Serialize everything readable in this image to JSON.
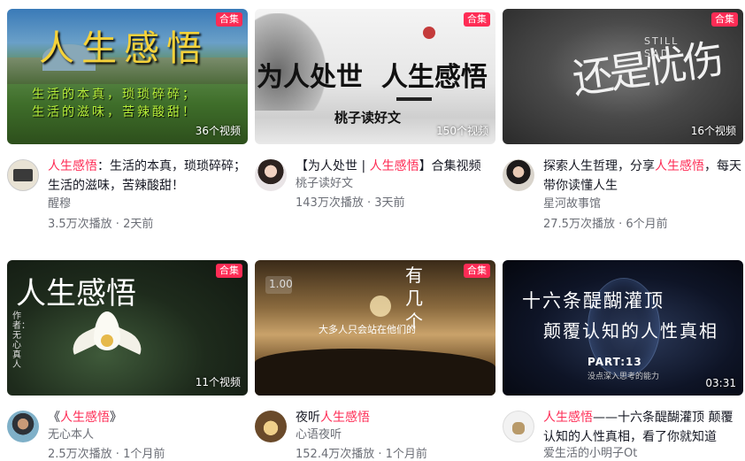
{
  "cards": [
    {
      "thumb_title": "人生感悟",
      "thumb_lines": [
        "生活的本真，琐琐碎碎；",
        "生活的滋味，苦辣酸甜！"
      ],
      "badge": "合集",
      "count": "36个视频",
      "title_pre": "",
      "title_hl": "人生感悟",
      "title_post": "：生活的本真，琐琐碎碎；生活的滋味，苦辣酸甜！",
      "author": "醒穆",
      "meta": "3.5万次播放 · 2天前"
    },
    {
      "thumb_title": "为人处世  人生感悟",
      "thumb_sub": "桃子读好文",
      "badge": "合集",
      "count": "150个视频",
      "title_pre": "【为人处世 | ",
      "title_hl": "人生感悟",
      "title_post": "】合集视频",
      "author": "桃子读好文",
      "meta": "143万次播放 · 3天前"
    },
    {
      "thumb_title": "还是忧伤",
      "thumb_sub": "STILL SAD",
      "badge": "合集",
      "count": "16个视频",
      "title_pre": "探索人生哲理，分享",
      "title_hl": "人生感悟",
      "title_post": "，每天带你读懂人生",
      "author": "星河故事馆",
      "meta": "27.5万次播放 · 6个月前"
    },
    {
      "thumb_title": "人生感悟",
      "thumb_sub": "作者：无心真人",
      "badge": "合集",
      "count": "11个视频",
      "title_pre": "《",
      "title_hl": "人生感悟",
      "title_post": "》",
      "author": "无心本人",
      "meta": "2.5万次播放 · 1个月前"
    },
    {
      "thumb_title": "有几个",
      "thumb_sub": "大多人只会站在他们的",
      "thumb_speed": "1.00",
      "badge": "合集",
      "title_pre": "夜听",
      "title_hl": "人生感悟",
      "title_post": "",
      "author": "心语夜听",
      "meta": "152.4万次播放 · 1个月前"
    },
    {
      "thumb_title": "十六条醍醐灌顶",
      "thumb_title2": "颠覆认知的人性真相",
      "thumb_part": "PART:13",
      "thumb_sub": "没点深入思考的能力",
      "duration": "03:31",
      "title_pre": "",
      "title_hl": "人生感悟",
      "title_post": "——十六条醍醐灌顶 颠覆认知的人性真相，看了你就知道",
      "author": "爱生活的小明子Ot",
      "meta": ""
    }
  ]
}
